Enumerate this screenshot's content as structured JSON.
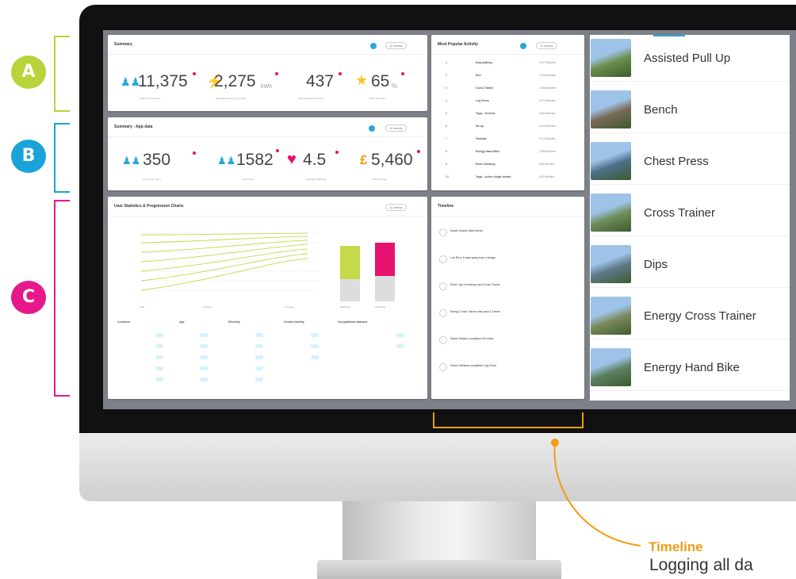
{
  "summary": {
    "title": "Summary",
    "filter": "11 weeks",
    "stats": [
      {
        "value": "11,375",
        "unit": "",
        "label": "Total User Sessions"
      },
      {
        "value": "2,275",
        "unit": "kWh",
        "label": "Estimated Energy Generated"
      },
      {
        "value": "437",
        "unit": "",
        "label": "Estimated Health Kudos"
      },
      {
        "value": "65",
        "unit": "%",
        "label": "Retention Rate"
      }
    ]
  },
  "summary_app": {
    "title": "Summary - App data",
    "filter": "11 weeks",
    "stats": [
      {
        "value": "350",
        "unit": "",
        "label": "Active App Users"
      },
      {
        "value": "1582",
        "unit": "",
        "label": "App Users"
      },
      {
        "value": "4.5",
        "unit": "",
        "label": "Average Wellbeing"
      },
      {
        "value": "5,460",
        "unit": "£",
        "label": "NHS Savings"
      }
    ]
  },
  "popular": {
    "title": "Most Popular Activity",
    "filter": "11 weeks",
    "rows": [
      {
        "rank": "1",
        "name": "Dog walking",
        "value": "1227 Minutes"
      },
      {
        "rank": "2",
        "name": "Run",
        "value": "1226 Minutes"
      },
      {
        "rank": "3",
        "name": "Cross Trainer",
        "value": "1206 Minutes"
      },
      {
        "rank": "4",
        "name": "Leg Press",
        "value": "1173 Minutes"
      },
      {
        "rank": "5",
        "name": "Yoga - General",
        "value": "1160 Minutes"
      },
      {
        "rank": "6",
        "name": "Sit up",
        "value": "1145 Minutes"
      },
      {
        "rank": "7",
        "name": "Football",
        "value": "1113 Minutes"
      },
      {
        "rank": "8",
        "name": "Energy Hand Bike",
        "value": "1006 Minutes"
      },
      {
        "rank": "9",
        "name": "Rock Climbing",
        "value": "948 Minutes"
      },
      {
        "rank": "10",
        "name": "Yoga - Active single breath",
        "value": "903 Minutes"
      }
    ]
  },
  "stats_panel": {
    "title": "User Statistics & Progression Charts",
    "filter": "11 weeks",
    "x_labels": [
      "Start",
      "5 weeks",
      "11 weeks"
    ],
    "bar_labels": [
      "Wellbeing",
      "Wellbeing"
    ],
    "bar_colors": [
      "#c5d94a",
      "#e6136e"
    ],
    "columns": [
      "Countries",
      "Age",
      "Ethnicity",
      "Gender Identity",
      "Occupational statuses"
    ]
  },
  "timeline": {
    "title": "Timeline",
    "items": [
      "Sarah Newton liked Bench",
      "Lee Ra is 5 days away from a badge",
      "Elmer Jay of midway used Cross Trainer",
      "Energy Cross Trainer was used 12 times",
      "Sarah Newton completed 3rd class",
      "Shaun Williams completed Leg Press"
    ]
  },
  "exercises": [
    {
      "name": "Assisted Pull Up"
    },
    {
      "name": "Bench"
    },
    {
      "name": "Chest Press"
    },
    {
      "name": "Cross Trainer"
    },
    {
      "name": "Dips"
    },
    {
      "name": "Energy Cross Trainer"
    },
    {
      "name": "Energy Hand Bike"
    }
  ],
  "annotations": {
    "badges": [
      "A",
      "B",
      "C"
    ],
    "badge_colors": [
      "#b8d43a",
      "#1aa3d8",
      "#e6188b"
    ],
    "caption_title": "Timeline",
    "caption_text": "Logging all da",
    "accent": "#f39c12"
  }
}
